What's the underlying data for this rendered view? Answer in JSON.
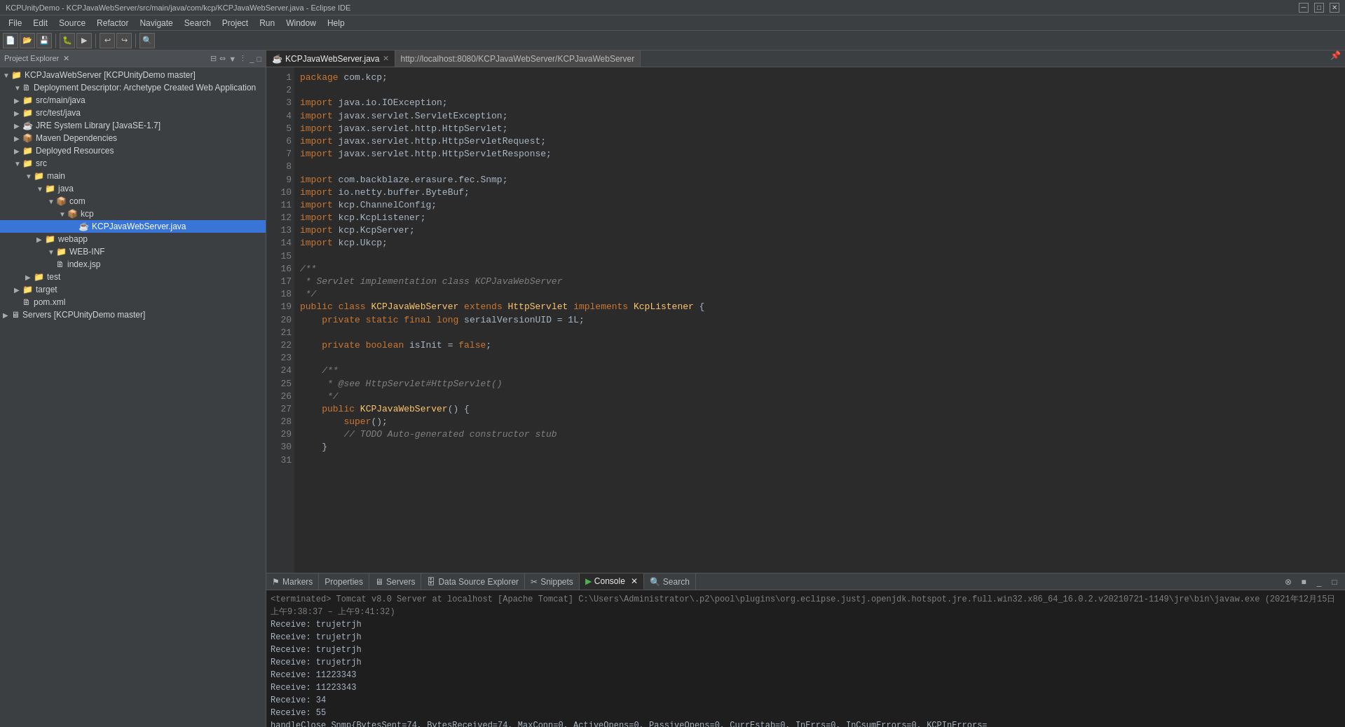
{
  "window": {
    "title": "KCPUnityDemo - KCPJavaWebServer/src/main/java/com/kcp/KCPJavaWebServer.java - Eclipse IDE"
  },
  "menubar": {
    "items": [
      "File",
      "Edit",
      "Source",
      "Refactor",
      "Navigate",
      "Search",
      "Project",
      "Run",
      "Window",
      "Help"
    ]
  },
  "explorer": {
    "title": "Project Explorer  ×",
    "tree": [
      {
        "level": 0,
        "arrow": "▼",
        "icon": "📁",
        "label": "KCPJavaWebServer [KCPUnityDemo master]",
        "selected": false
      },
      {
        "level": 1,
        "arrow": "▼",
        "icon": "🗎",
        "label": "Deployment Descriptor: Archetype Created Web Application",
        "selected": false
      },
      {
        "level": 1,
        "arrow": "▶",
        "icon": "📁",
        "label": "src/main/java",
        "selected": false
      },
      {
        "level": 1,
        "arrow": "▶",
        "icon": "📁",
        "label": "src/test/java",
        "selected": false
      },
      {
        "level": 1,
        "arrow": "▶",
        "icon": "☕",
        "label": "JRE System Library [JavaSE-1.7]",
        "selected": false
      },
      {
        "level": 1,
        "arrow": "▶",
        "icon": "📦",
        "label": "Maven Dependencies",
        "selected": false
      },
      {
        "level": 1,
        "arrow": "▼",
        "icon": "📁",
        "label": "Deployed Resources",
        "selected": false
      },
      {
        "level": 1,
        "arrow": "▼",
        "icon": "📁",
        "label": "src",
        "selected": false
      },
      {
        "level": 2,
        "arrow": "▼",
        "icon": "📁",
        "label": "main",
        "selected": false
      },
      {
        "level": 3,
        "arrow": "▼",
        "icon": "📁",
        "label": "java",
        "selected": false
      },
      {
        "level": 4,
        "arrow": "▼",
        "icon": "📦",
        "label": "com",
        "selected": false
      },
      {
        "level": 5,
        "arrow": "▼",
        "icon": "📦",
        "label": "kcp",
        "selected": false
      },
      {
        "level": 6,
        "arrow": "",
        "icon": "☕",
        "label": "KCPJavaWebServer.java",
        "selected": true
      },
      {
        "level": 3,
        "arrow": "▶",
        "icon": "📁",
        "label": "webapp",
        "selected": false
      },
      {
        "level": 4,
        "arrow": "▼",
        "icon": "📁",
        "label": "WEB-INF",
        "selected": false
      },
      {
        "level": 4,
        "arrow": "",
        "icon": "🗎",
        "label": "index.jsp",
        "selected": false
      },
      {
        "level": 2,
        "arrow": "▶",
        "icon": "📁",
        "label": "test",
        "selected": false
      },
      {
        "level": 1,
        "arrow": "▶",
        "icon": "📁",
        "label": "target",
        "selected": false
      },
      {
        "level": 1,
        "arrow": "",
        "icon": "🗎",
        "label": "pom.xml",
        "selected": false
      },
      {
        "level": 0,
        "arrow": "▶",
        "icon": "🖥",
        "label": "Servers [KCPUnityDemo master]",
        "selected": false
      }
    ]
  },
  "editor": {
    "tabs": [
      {
        "label": "KCPJavaWebServer.java",
        "active": true,
        "closeable": true
      },
      {
        "label": "http://localhost:8080/KCPJavaWebServer/KCPJavaWebServer",
        "active": false,
        "closeable": false
      }
    ],
    "filename": "KCPJavaWebServer.java",
    "url": "http://localhost:8080/KCPJavaWebServer/KCPJavaWebServer"
  },
  "bottom_panel": {
    "tabs": [
      {
        "label": "Markers",
        "active": false,
        "icon": "⚑"
      },
      {
        "label": "Properties",
        "active": false,
        "icon": ""
      },
      {
        "label": "Servers",
        "active": false,
        "icon": "🖥"
      },
      {
        "label": "Data Source Explorer",
        "active": false,
        "icon": "🗄"
      },
      {
        "label": "Snippets",
        "active": false,
        "icon": "✂"
      },
      {
        "label": "Console",
        "active": true,
        "icon": "▶"
      },
      {
        "label": "Search",
        "active": false,
        "icon": "🔍"
      }
    ],
    "console": {
      "terminated_line": "<terminated> Tomcat v8.0 Server at localhost [Apache Tomcat] C:\\Users\\Administrator\\.p2\\pool\\plugins\\org.eclipse.justj.openjdk.hotspot.jre.full.win32.x86_64_16.0.2.v20210721-1149\\jre\\bin\\javaw.exe  (2021年12月15日 上午9:38:37 – 上午9:41:32)",
      "output_lines": [
        "Receive: trujetrjh",
        "Receive: trujetrjh",
        "Receive: trujetrjh",
        "Receive: trujetrjh",
        "Receive: 11223343",
        "Receive: 11223343",
        "Receive: 34",
        "Receive: 55",
        "handleClose Snmp{BytesSent=74, BytesReceived=74, MaxConn=0, ActiveOpens=0, PassiveOpens=0, CurrEstab=0, InErrs=0, InCsumErrors=0, KCPInErrors="
      ]
    }
  },
  "statusbar": {
    "text": ""
  }
}
